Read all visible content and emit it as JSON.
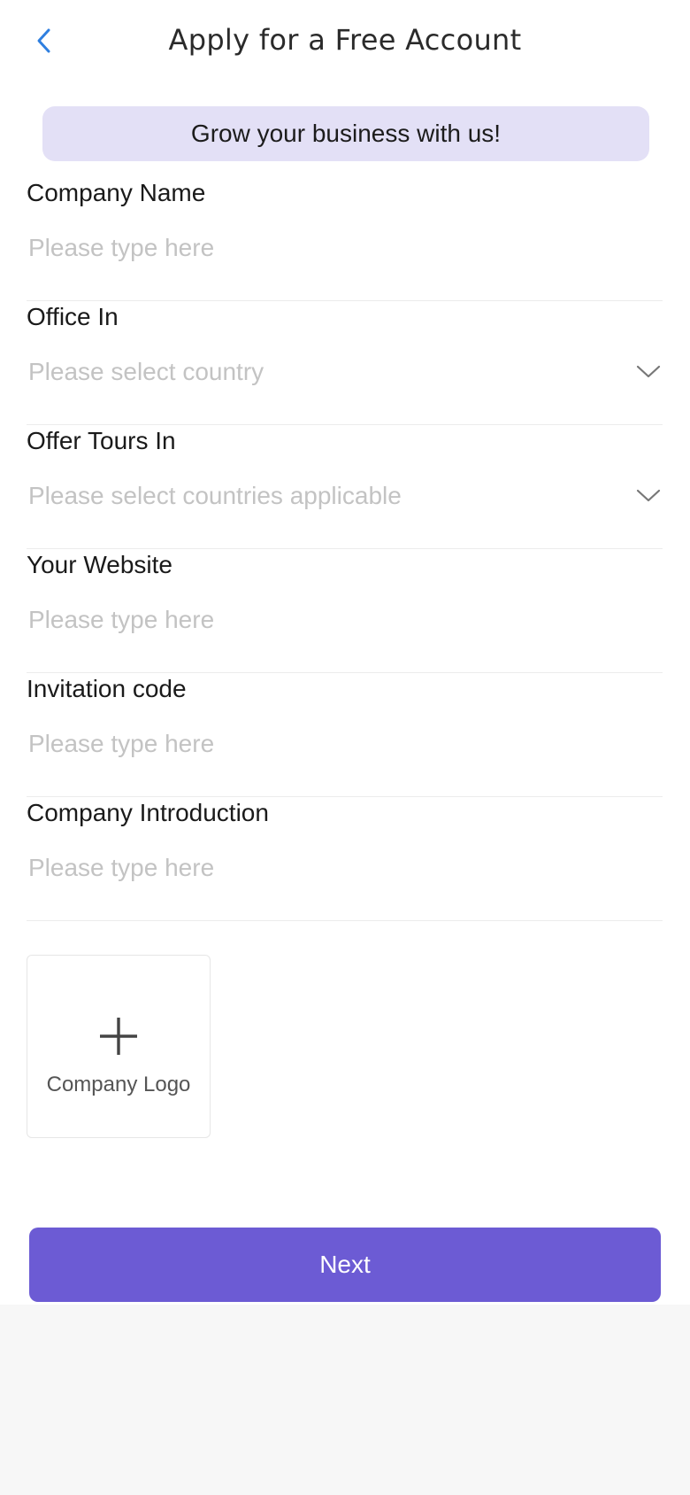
{
  "header": {
    "back_icon": "chevron-left-icon",
    "title": "Apply for a Free Account"
  },
  "banner": {
    "text": "Grow your business with us!"
  },
  "form": {
    "company_name": {
      "label": "Company Name",
      "placeholder": "Please type here"
    },
    "office_in": {
      "label": "Office In",
      "placeholder": "Please select country",
      "icon": "chevron-down-icon"
    },
    "offer_tours_in": {
      "label": "Offer Tours In",
      "placeholder": "Please select countries applicable",
      "icon": "chevron-down-icon"
    },
    "website": {
      "label": "Your Website",
      "placeholder": "Please type here"
    },
    "invitation_code": {
      "label": "Invitation code",
      "placeholder": "Please type here"
    },
    "company_intro": {
      "label": "Company Introduction",
      "placeholder": "Please type here"
    }
  },
  "upload": {
    "icon": "plus-icon",
    "label": "Company Logo"
  },
  "actions": {
    "next_label": "Next"
  },
  "colors": {
    "accent": "#6c5bd4",
    "banner_bg": "#e3e0f6",
    "back_icon": "#2f7fe0",
    "placeholder": "#c3c3c3"
  }
}
